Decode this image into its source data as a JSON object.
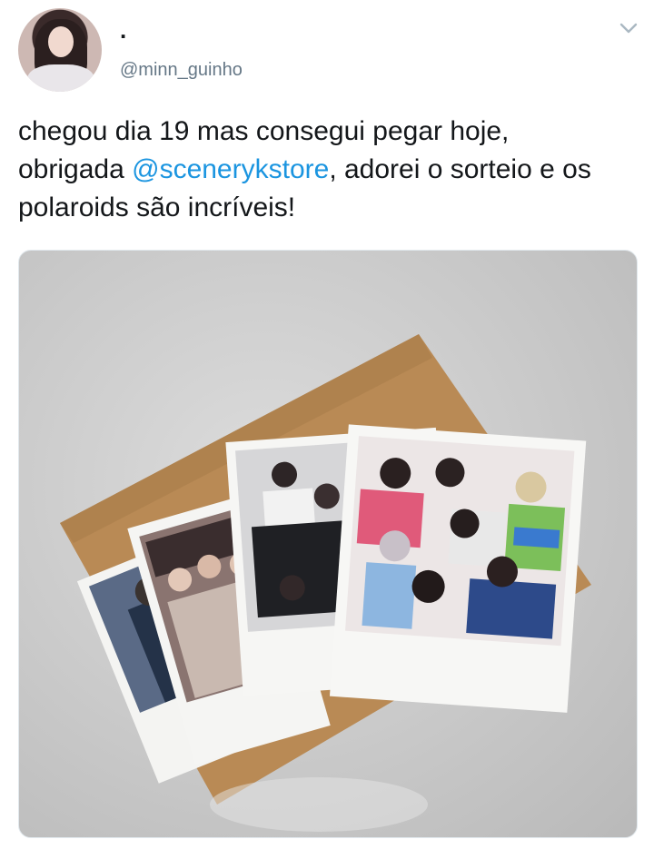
{
  "tweet": {
    "display_name": ".",
    "handle": "@minn_guinho",
    "text_before_mention": "chegou dia 19 mas consegui pegar hoje,\nobrigada ",
    "mention": "@scenerykstore",
    "text_after_mention": ", adorei o sorteio e os polaroids são incríveis!"
  },
  "icons": {
    "menu": "chevron-down-icon"
  },
  "colors": {
    "text": "#14171a",
    "secondary": "#657786",
    "link": "#1b95e0"
  }
}
